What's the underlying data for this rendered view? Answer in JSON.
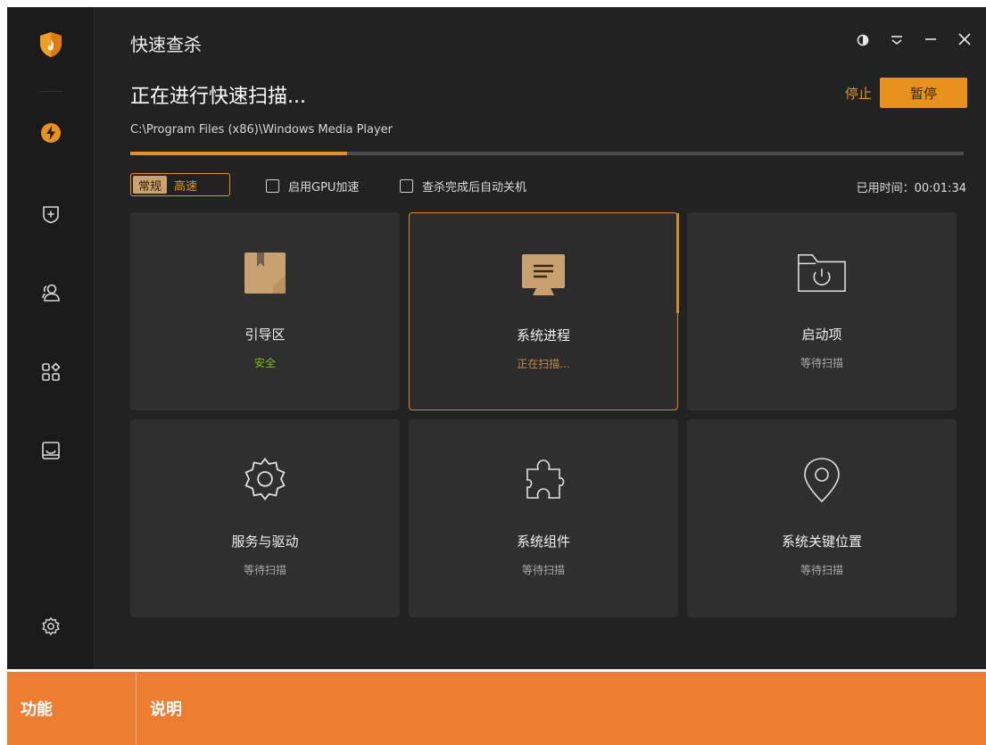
{
  "app": {
    "title": "快速查杀",
    "scan_heading": "正在进行快速扫描...",
    "stop_label": "停止",
    "pause_label": "暂停",
    "current_path": "C:\\Program Files (x86)\\Windows Media Player",
    "progress_percent": 26,
    "accent_color": "#e8921d"
  },
  "sidebar": {
    "items": [
      {
        "icon": "shield-flame-icon"
      },
      {
        "icon": "lightning-icon"
      },
      {
        "icon": "plus-shield-icon"
      },
      {
        "icon": "users-icon"
      },
      {
        "icon": "apps-icon"
      },
      {
        "icon": "tray-icon"
      },
      {
        "icon": "gear-icon"
      }
    ]
  },
  "options": {
    "mode_normal": "常规",
    "mode_fast": "高速",
    "gpu_label": "启用GPU加速",
    "gpu_checked": false,
    "shutdown_label": "查杀完成后自动关机",
    "shutdown_checked": false,
    "elapsed_label": "已用时间：00:01:34"
  },
  "cards": [
    {
      "name": "引导区",
      "status": "安全",
      "status_color": "#7cb518",
      "icon": "boot-box-icon"
    },
    {
      "name": "系统进程",
      "status": "正在扫描...",
      "status_color": "#c08a4a",
      "icon": "monitor-icon"
    },
    {
      "name": "启动项",
      "status": "等待扫描",
      "status_color": "#aaaaaa",
      "icon": "power-folder-icon"
    },
    {
      "name": "服务与驱动",
      "status": "等待扫描",
      "status_color": "#aaaaaa",
      "icon": "gear-icon"
    },
    {
      "name": "系统组件",
      "status": "等待扫描",
      "status_color": "#aaaaaa",
      "icon": "puzzle-icon"
    },
    {
      "name": "系统关键位置",
      "status": "等待扫描",
      "status_color": "#aaaaaa",
      "icon": "location-pin-icon"
    }
  ],
  "table": {
    "headers": [
      "功能",
      "说明"
    ]
  }
}
